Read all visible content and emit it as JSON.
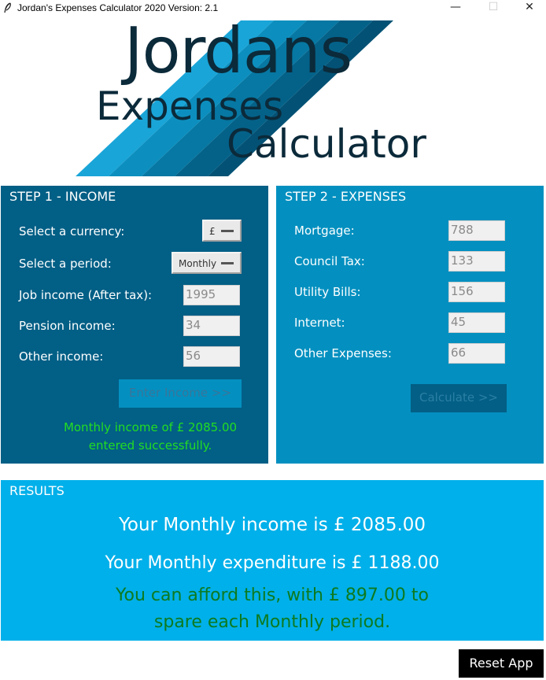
{
  "window": {
    "title": "Jordan's Expenses Calculator 2020  Version: 2.1",
    "minimize": "—",
    "maximize": "☐",
    "close": "✕"
  },
  "logo": {
    "line1": "Jordans",
    "line2": "Expenses",
    "line3": "Calculator"
  },
  "income": {
    "title": "STEP 1 - INCOME",
    "currency_label": "Select a currency:",
    "currency_value": "£",
    "period_label": "Select a period:",
    "period_value": "Monthly",
    "job_label": "Job income (After tax):",
    "job_value": "1995",
    "pension_label": "Pension income:",
    "pension_value": "34",
    "other_label": "Other income:",
    "other_value": "56",
    "enter_button": "Enter Income >>",
    "message_line1": "Monthly income of £ 2085.00",
    "message_line2": "entered successfully."
  },
  "expenses": {
    "title": "STEP 2 - EXPENSES",
    "mortgage_label": "Mortgage:",
    "mortgage_value": "788",
    "council_label": "Council Tax:",
    "council_value": "133",
    "utility_label": "Utility Bills:",
    "utility_value": "156",
    "internet_label": "Internet:",
    "internet_value": "45",
    "other_label": "Other Expenses:",
    "other_value": "66",
    "calculate_button": "Calculate >>"
  },
  "results": {
    "title": "RESULTS",
    "income_line": "Your Monthly income is £ 2085.00",
    "expenditure_line": "Your Monthly expenditure is £ 1188.00",
    "afford_line": "You can afford this, with £ 897.00 to spare each Monthly period."
  },
  "reset_button": "Reset App",
  "colors": {
    "income_panel": "#025f86",
    "expenses_panel": "#0390c0",
    "results_panel": "#00b0ea",
    "success_green": "#22dd22",
    "afford_green": "#0d7a1f",
    "logo_text": "#0b2a3a"
  },
  "icons": {
    "app_icon": "feather-icon",
    "select_indicator": "dropdown-bar-icon"
  }
}
